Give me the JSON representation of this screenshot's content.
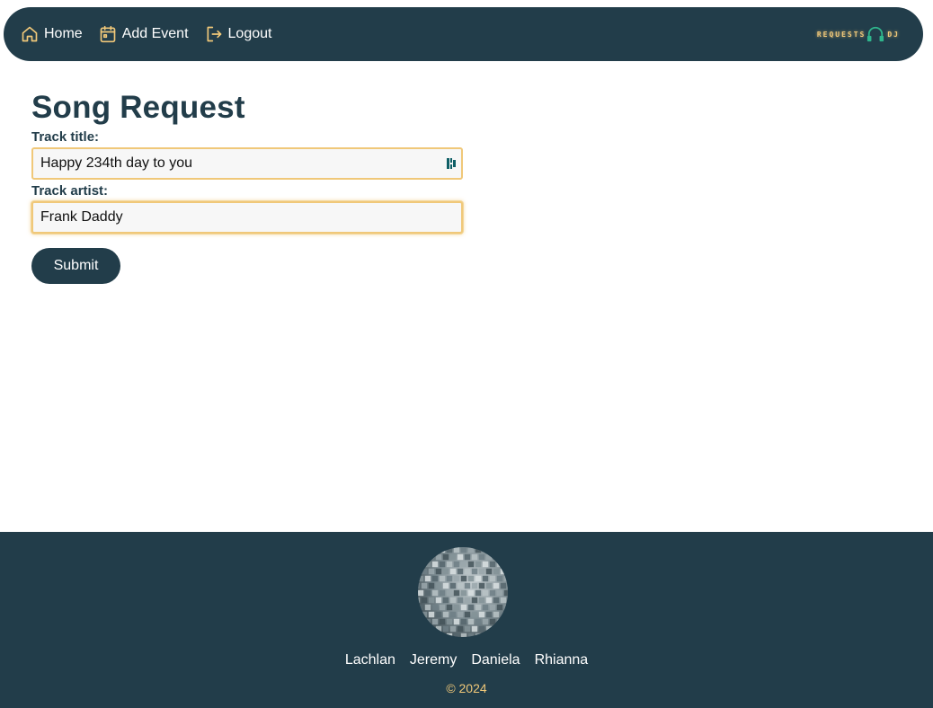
{
  "nav": {
    "home_label": "Home",
    "add_event_label": "Add Event",
    "logout_label": "Logout",
    "brand_left": "REQUESTS",
    "brand_right": "DJ"
  },
  "form": {
    "title": "Song Request",
    "track_title_label": "Track title:",
    "track_title_value": "Happy 234th day to you",
    "track_artist_label": "Track artist:",
    "track_artist_value": "Frank Daddy",
    "submit_label": "Submit"
  },
  "footer": {
    "names": [
      "Lachlan",
      "Jeremy",
      "Daniela",
      "Rhianna"
    ],
    "copyright": "© 2024"
  },
  "colors": {
    "navy": "#223d4a",
    "gold": "#f0c879",
    "teal": "#2fb58c"
  },
  "icons": [
    "home-icon",
    "calendar-icon",
    "logout-icon",
    "headphones-icon",
    "password-manager-icon",
    "disco-ball-icon"
  ]
}
